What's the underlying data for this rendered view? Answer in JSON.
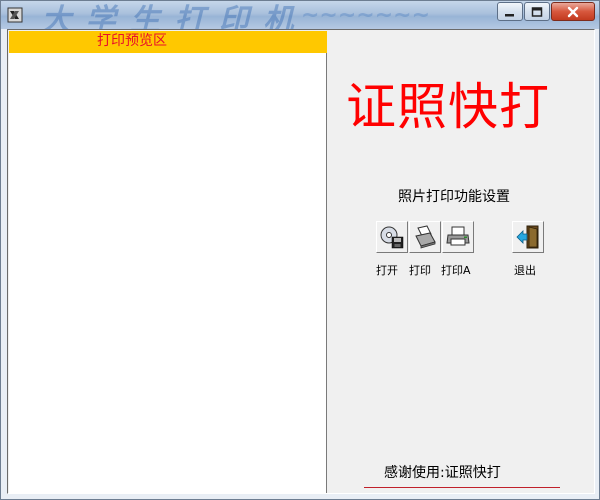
{
  "window": {
    "controls": {
      "minimize_icon": "minimize-icon",
      "maximize_icon": "maximize-icon",
      "close_icon": "close-icon"
    }
  },
  "preview": {
    "header": "打印预览区",
    "header_bg": "#ffc800",
    "header_color": "#e8102a"
  },
  "panel": {
    "app_title": "证照快打",
    "title_color": "#ff0000",
    "settings_label": "照片打印功能设置",
    "tools": [
      {
        "label": "打开",
        "icon": "open-disk-icon"
      },
      {
        "label": "打印",
        "icon": "print-icon"
      },
      {
        "label": "打印A",
        "icon": "printer-icon"
      },
      {
        "label": "退出",
        "icon": "exit-door-icon"
      }
    ]
  },
  "footer": {
    "text": "感谢使用:证照快打",
    "line_color": "#c0202a"
  }
}
